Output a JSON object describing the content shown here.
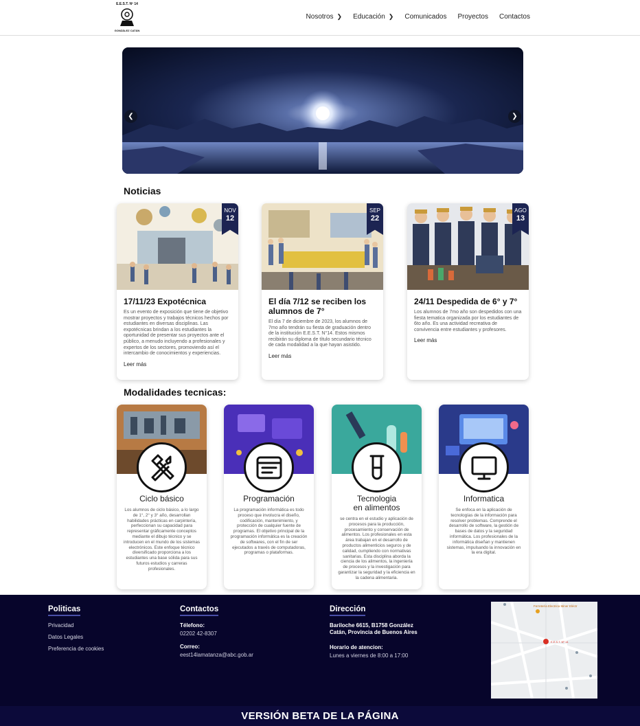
{
  "header": {
    "logo_text_top": "E.E.S.T. Nº 14",
    "logo_text_bottom": "GONZÁLEZ CATÁN",
    "nav": [
      {
        "label": "Nosotros",
        "has_submenu": true
      },
      {
        "label": "Educación",
        "has_submenu": true
      },
      {
        "label": "Comunicados",
        "has_submenu": false
      },
      {
        "label": "Proyectos",
        "has_submenu": false
      },
      {
        "label": "Contactos",
        "has_submenu": false
      }
    ]
  },
  "hero": {
    "prev_icon": "chevron-left-icon",
    "next_icon": "chevron-right-icon"
  },
  "news": {
    "title": "Noticias",
    "items": [
      {
        "month": "NOV",
        "day": "12",
        "title": "17/11/23 Expotécnica",
        "text": "Es un evento de exposición que tiene de objetivo mostrar proyectos y trabajos técnicos hechos por estudiantes en diversas disciplinas. Las expotécnicas brindan a los estudiantes la oportunidad de presentar sus proyectos ante el público, a menudo incluyendo a profesionales y expertos de los sectores, promoviendo así el intercambio de conocimientos y experiencias.",
        "link": "Leer más"
      },
      {
        "month": "SEP",
        "day": "22",
        "title": "El día 7/12 se reciben los alumnos de 7°",
        "text": "El día 7 de diciembre de 2023, los alumnos de 7mo año tendrán su fiesta de graduación dentro de la institución E.E.S.T. N°14. Estos mismos recibirán su diploma de título secundario técnico de cada modalidad a la que hayan asistido.",
        "link": "Leer más"
      },
      {
        "month": "AGO",
        "day": "13",
        "title": "24/11 Despedida de 6° y 7°",
        "text": "Los alumnos de 7mo año son despedidos con una fiesta tematica organizada por los estudiantes de 6to año. Es una actividad recreativa de convivencia entre estudiantes y profesores.",
        "link": "Leer más"
      }
    ]
  },
  "modalities": {
    "title": "Modalidades tecnicas:",
    "items": [
      {
        "title": "Ciclo básico",
        "icon": "hammer-wrench-icon",
        "text": "Los alumnos de ciclo básico, a lo largo de 1°, 2° y 3° año, desarrollan habilidades prácticas en carpintería, perfeccionan su capacidad para representar gráficamente conceptos mediante el dibujo técnico y se introducen en el mundo de los sistemas electrónicos. Este enfoque técnico diversificado proporciona a los estudiantes una base sólida para sus futuros estudios y carreras profesionales."
      },
      {
        "title": "Programación",
        "icon": "code-window-icon",
        "text": "La programación informática es todo proceso que involucra el diseño, codificación, mantenimiento, y protección de cualquier fuente de programas. El objetivo principal de la programación informática es la creación de softwares, con el fin de ser ejecutados a través de computadoras, programas o plataformas."
      },
      {
        "title": "Tecnologia en alimentos",
        "icon": "test-tube-icon",
        "text": "se centra en el estudio y aplicación de procesos para la producción, procesamiento y conservación de alimentos. Los profesionales en esta área trabajan en el desarrollo de productos alimenticios seguros y de calidad, cumpliendo con normativas sanitarias. Esta disciplina aborda la ciencia de los alimentos, la ingeniería de procesos y la investigación para garantizar la seguridad y la eficiencia en la cadena alimentaria."
      },
      {
        "title": "Informatica",
        "icon": "monitor-icon",
        "text": "Se enfoca en la aplicación de tecnologías de la información para resolver problemas. Comprende el desarrollo de software, la gestión de bases de datos y la seguridad informática. Los profesionales de la informática diseñan y mantienen sistemas, impulsando la innovación en la era digital."
      }
    ]
  },
  "footer": {
    "policies": {
      "title": "Politicas",
      "links": [
        "Privacidad",
        "Datos Legales",
        "Preferencia de cookies"
      ]
    },
    "contacts": {
      "title": "Contactos",
      "phone_label": "Télefono:",
      "phone": "02202 42-8307",
      "email_label": "Correo:",
      "email": "eest14lamatanza@abc.gob.ar"
    },
    "address": {
      "title": "Dirección",
      "address": "Bariloche 6615, B1758 González Catán, Provincia de Buenos Aires",
      "hours_label": "Horario de atencion:",
      "hours": "Lunes a viernes de 8:00 a 17:00"
    },
    "map": {
      "place_label": "E.E.S.T. Nº 14",
      "poi_label": "Ferretería Electrica Miner Eléctr"
    }
  },
  "beta_banner": "VERSIÓN BETA DE LA PÁGINA",
  "colors": {
    "footer_bg": "#07052b",
    "badge_bg": "#1c2452",
    "accent_underline": "#4a4fa8"
  }
}
